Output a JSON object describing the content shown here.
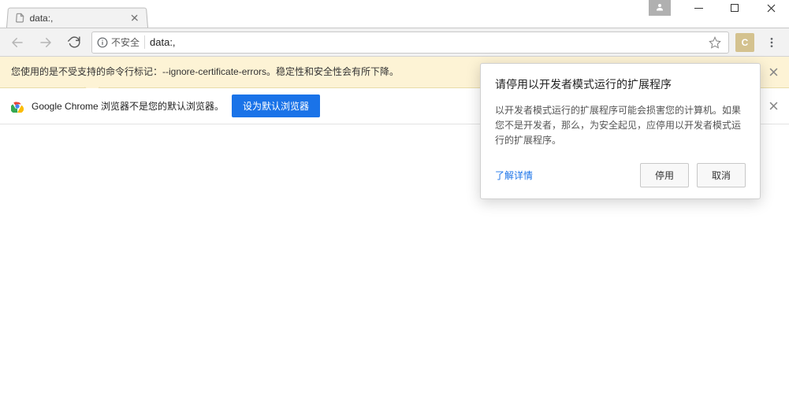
{
  "window": {
    "controls": {
      "minimize": "–",
      "maximize": "☐",
      "close": "✕"
    }
  },
  "tab": {
    "title": "data:,",
    "favicon": "page-icon"
  },
  "toolbar": {
    "security_label": "不安全",
    "url_value": "data:,",
    "extension_badge_letter": "C"
  },
  "yellow_bar": {
    "text": "您使用的是不受支持的命令行标记：--ignore-certificate-errors。稳定性和安全性会有所下降。"
  },
  "default_browser_bar": {
    "text": "Google Chrome 浏览器不是您的默认浏览器。",
    "button_label": "设为默认浏览器"
  },
  "dev_mode_popover": {
    "title": "请停用以开发者模式运行的扩展程序",
    "body": "以开发者模式运行的扩展程序可能会损害您的计算机。如果您不是开发者，那么，为安全起见，应停用以开发者模式运行的扩展程序。",
    "learn_more": "了解详情",
    "disable_button": "停用",
    "cancel_button": "取消"
  }
}
